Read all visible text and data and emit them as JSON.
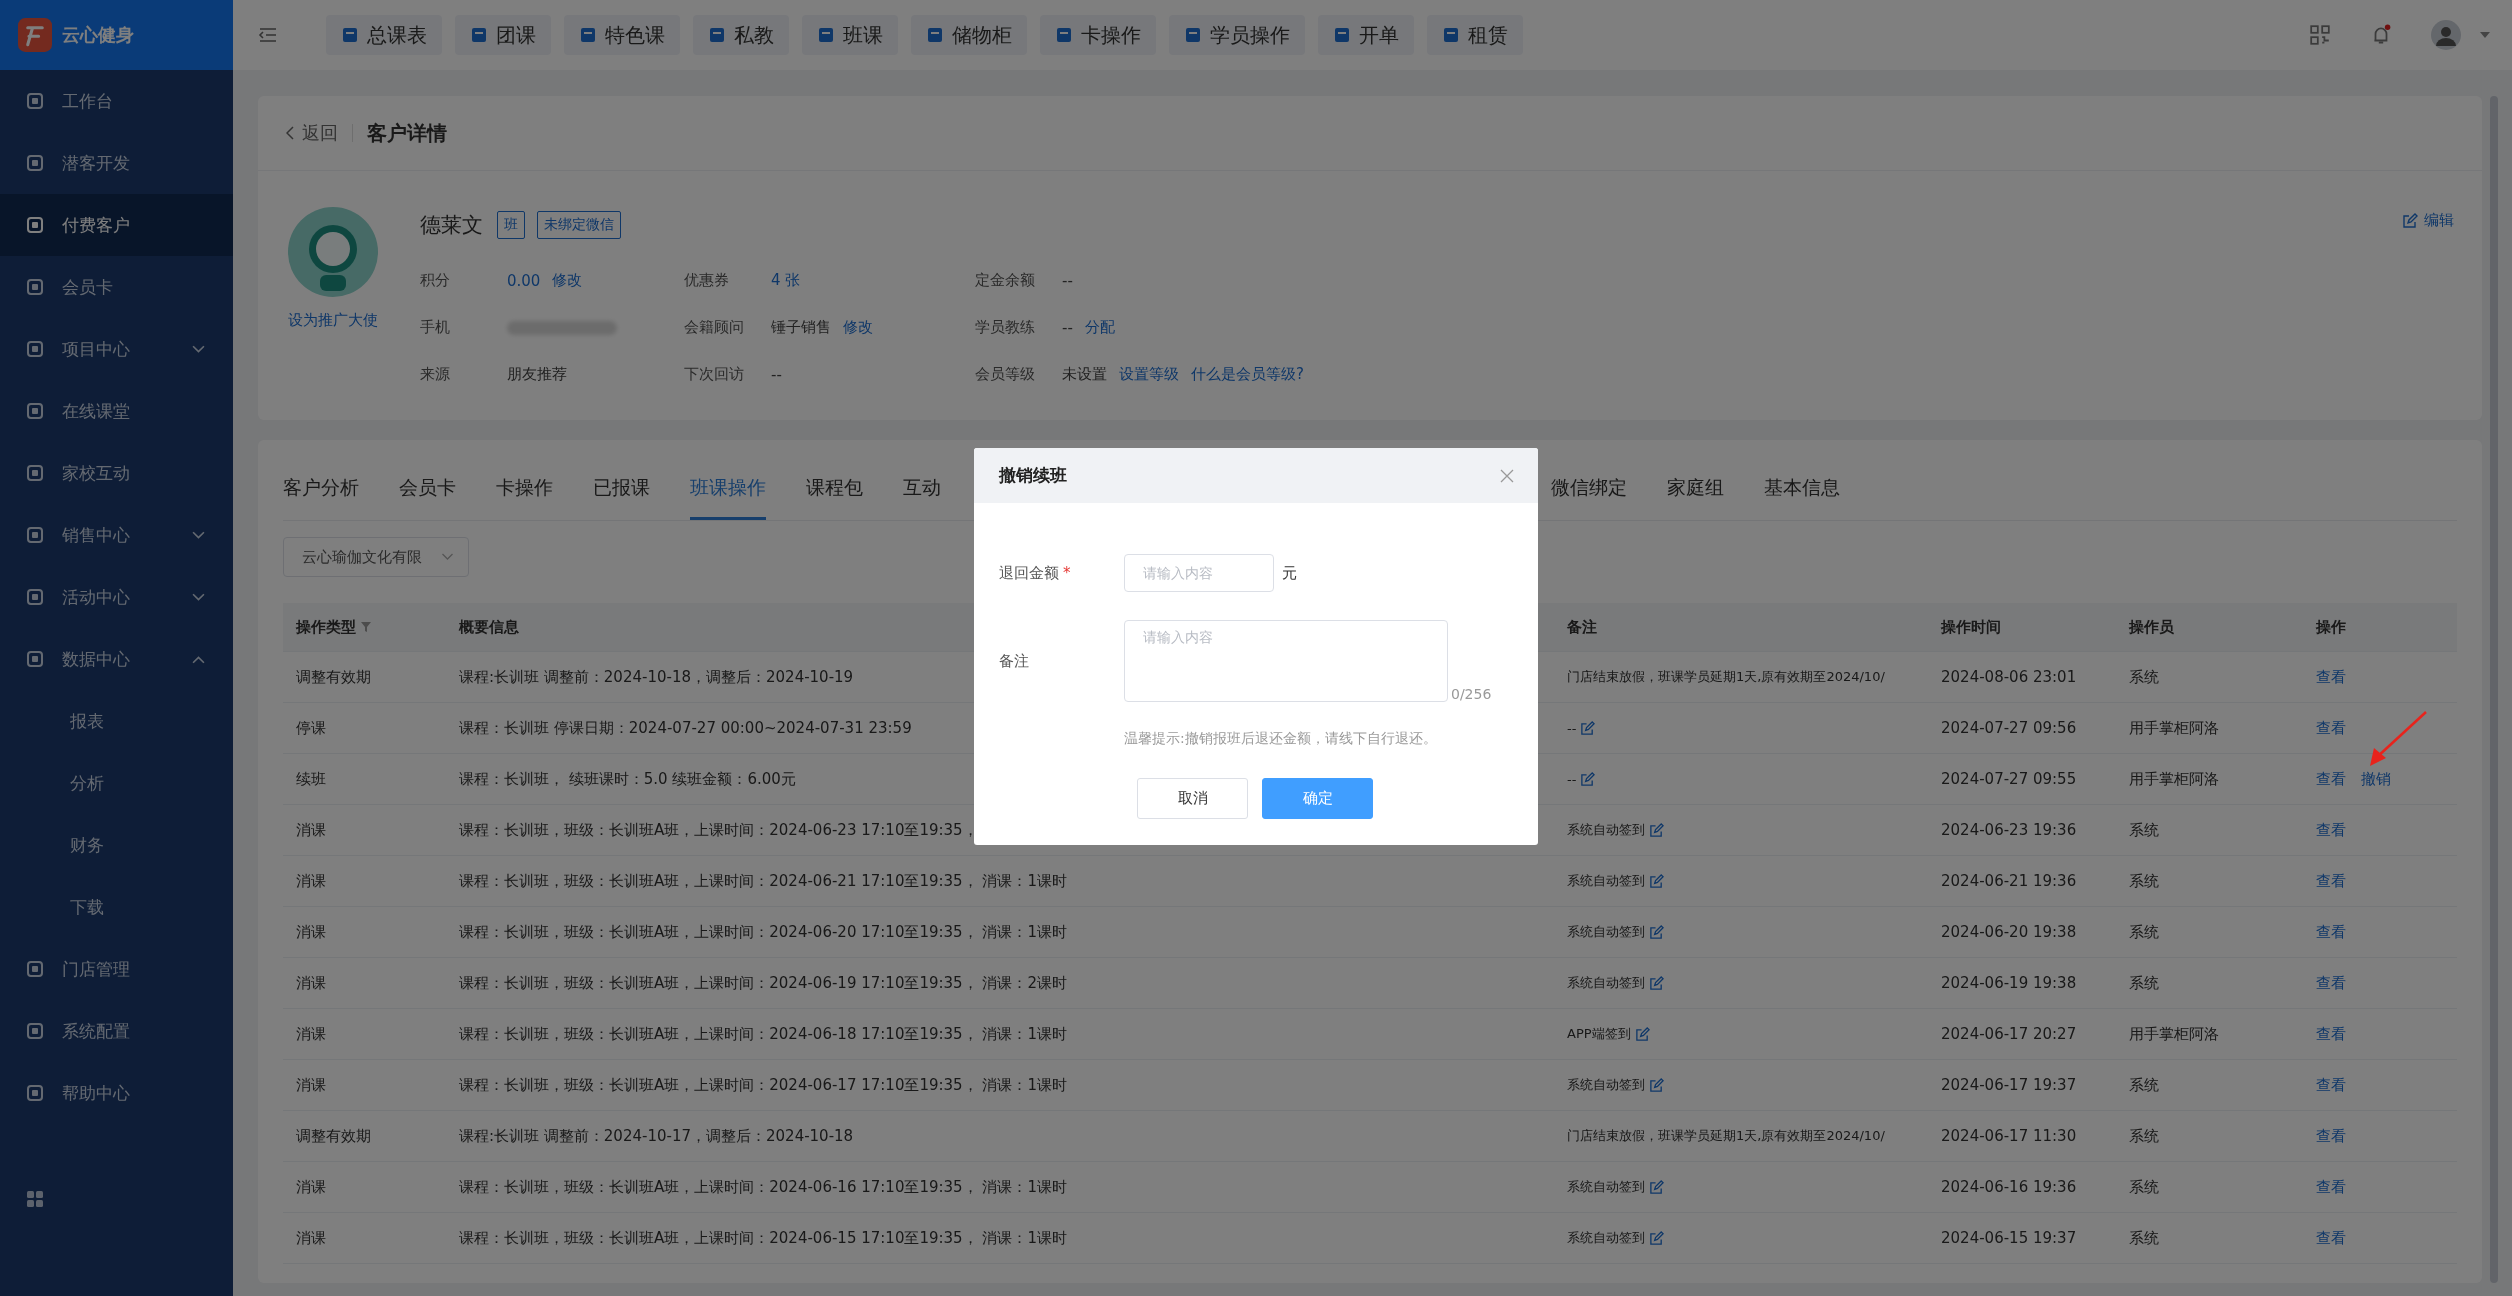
{
  "sidebar": {
    "brand": "云心健身",
    "items": [
      {
        "label": "工作台",
        "selected": false
      },
      {
        "label": "潜客开发",
        "selected": false
      },
      {
        "label": "付费客户",
        "selected": true
      },
      {
        "label": "会员卡",
        "selected": false
      },
      {
        "label": "项目中心",
        "selected": false,
        "expanded": false
      },
      {
        "label": "在线课堂",
        "selected": false
      },
      {
        "label": "家校互动",
        "selected": false
      },
      {
        "label": "销售中心",
        "selected": false,
        "expanded": false
      },
      {
        "label": "活动中心",
        "selected": false,
        "expanded": false
      },
      {
        "label": "数据中心",
        "selected": false,
        "expanded": true,
        "children": [
          {
            "label": "报表",
            "selected": false
          },
          {
            "label": "分析",
            "selected": false
          },
          {
            "label": "财务",
            "selected": false
          },
          {
            "label": "下载",
            "selected": false
          }
        ]
      },
      {
        "label": "门店管理",
        "selected": false
      },
      {
        "label": "系统配置",
        "selected": false
      },
      {
        "label": "帮助中心",
        "selected": false
      }
    ]
  },
  "topbar": {
    "nav": [
      "总课表",
      "团课",
      "特色课",
      "私教",
      "班课",
      "储物柜",
      "卡操作",
      "学员操作",
      "开单",
      "租赁"
    ],
    "notification_dot": true
  },
  "page": {
    "back": "返回",
    "title": "客户详情",
    "edit": "编辑"
  },
  "customer": {
    "ambassador_link": "设为推广大使",
    "name": "德莱文",
    "tags": [
      "班",
      "未绑定微信"
    ],
    "fields": [
      {
        "label": "积分",
        "kind": "link",
        "value": "0.00",
        "links": [
          "修改"
        ]
      },
      {
        "label": "优惠券",
        "kind": "link",
        "value": "4 张"
      },
      {
        "label": "定金余额",
        "kind": "text",
        "value": "--"
      },
      {
        "label": "手机",
        "kind": "blurred"
      },
      {
        "label": "会籍顾问",
        "kind": "text",
        "value": "锤子销售",
        "links": [
          "修改"
        ]
      },
      {
        "label": "学员教练",
        "kind": "text",
        "value": "--",
        "links": [
          "分配"
        ]
      },
      {
        "label": "来源",
        "kind": "text",
        "value": "朋友推荐"
      },
      {
        "label": "下次回访",
        "kind": "text",
        "value": "--"
      },
      {
        "label": "会员等级",
        "kind": "text",
        "value": "未设置",
        "links": [
          "设置等级",
          "什么是会员等级?"
        ]
      }
    ]
  },
  "tabs": [
    {
      "label": "客户分析",
      "selected": false
    },
    {
      "label": "会员卡",
      "selected": false
    },
    {
      "label": "卡操作",
      "selected": false
    },
    {
      "label": "已报课",
      "selected": false
    },
    {
      "label": "班课操作",
      "selected": true
    },
    {
      "label": "课程包",
      "selected": false
    },
    {
      "label": "互动",
      "selected": false
    },
    {
      "label": "微信绑定",
      "selected": false
    },
    {
      "label": "家庭组",
      "selected": false
    },
    {
      "label": "基本信息",
      "selected": false
    }
  ],
  "filter": {
    "value": "云心瑜伽文化有限"
  },
  "table": {
    "columns": [
      {
        "label": "操作类型",
        "filter": true
      },
      {
        "label": "概要信息"
      },
      {
        "label": "备注"
      },
      {
        "label": "操作时间"
      },
      {
        "label": "操作员"
      },
      {
        "label": "操作"
      }
    ],
    "rows": [
      {
        "type": "调整有效期",
        "summary": "课程:长训班 调整前：2024-10-18，调整后：2024-10-19",
        "remark": "门店结束放假，班课学员延期1天,原有效期至2024/10/",
        "remark_editable": false,
        "time": "2024-08-06 23:01",
        "operator": "系统",
        "actions": [
          "查看"
        ]
      },
      {
        "type": "停课",
        "summary": "课程：长训班 停课日期：2024-07-27 00:00~2024-07-31 23:59",
        "remark": "--",
        "remark_editable": true,
        "time": "2024-07-27 09:56",
        "operator": "用手掌柜阿洛",
        "actions": [
          "查看"
        ]
      },
      {
        "type": "续班",
        "summary": "课程：长训班， 续班课时：5.0 续班金额：6.00元",
        "remark": "--",
        "remark_editable": true,
        "time": "2024-07-27 09:55",
        "operator": "用手掌柜阿洛",
        "actions": [
          "查看",
          "撤销"
        ]
      },
      {
        "type": "消课",
        "summary": "课程：长训班，班级：长训班A班，上课时间：2024-06-23 17:10至19:35，",
        "remark": "系统自动签到",
        "remark_editable": true,
        "time": "2024-06-23 19:36",
        "operator": "系统",
        "actions": [
          "查看"
        ]
      },
      {
        "type": "消课",
        "summary": "课程：长训班，班级：长训班A班，上课时间：2024-06-21 17:10至19:35， 消课：1课时",
        "remark": "系统自动签到",
        "remark_editable": true,
        "time": "2024-06-21 19:36",
        "operator": "系统",
        "actions": [
          "查看"
        ]
      },
      {
        "type": "消课",
        "summary": "课程：长训班，班级：长训班A班，上课时间：2024-06-20 17:10至19:35， 消课：1课时",
        "remark": "系统自动签到",
        "remark_editable": true,
        "time": "2024-06-20 19:38",
        "operator": "系统",
        "actions": [
          "查看"
        ]
      },
      {
        "type": "消课",
        "summary": "课程：长训班，班级：长训班A班，上课时间：2024-06-19 17:10至19:35， 消课：2课时",
        "remark": "系统自动签到",
        "remark_editable": true,
        "time": "2024-06-19 19:38",
        "operator": "系统",
        "actions": [
          "查看"
        ]
      },
      {
        "type": "消课",
        "summary": "课程：长训班，班级：长训班A班，上课时间：2024-06-18 17:10至19:35， 消课：1课时",
        "remark": "APP端签到",
        "remark_editable": true,
        "time": "2024-06-17 20:27",
        "operator": "用手掌柜阿洛",
        "actions": [
          "查看"
        ]
      },
      {
        "type": "消课",
        "summary": "课程：长训班，班级：长训班A班，上课时间：2024-06-17 17:10至19:35， 消课：1课时",
        "remark": "系统自动签到",
        "remark_editable": true,
        "time": "2024-06-17 19:37",
        "operator": "系统",
        "actions": [
          "查看"
        ]
      },
      {
        "type": "调整有效期",
        "summary": "课程:长训班 调整前：2024-10-17，调整后：2024-10-18",
        "remark": "门店结束放假，班课学员延期1天,原有效期至2024/10/",
        "remark_editable": false,
        "time": "2024-06-17 11:30",
        "operator": "系统",
        "actions": [
          "查看"
        ]
      },
      {
        "type": "消课",
        "summary": "课程：长训班，班级：长训班A班，上课时间：2024-06-16 17:10至19:35， 消课：1课时",
        "remark": "系统自动签到",
        "remark_editable": true,
        "time": "2024-06-16 19:36",
        "operator": "系统",
        "actions": [
          "查看"
        ]
      },
      {
        "type": "消课",
        "summary": "课程：长训班，班级：长训班A班，上课时间：2024-06-15 17:10至19:35， 消课：1课时",
        "remark": "系统自动签到",
        "remark_editable": true,
        "time": "2024-06-15 19:37",
        "operator": "系统",
        "actions": [
          "查看"
        ]
      }
    ]
  },
  "modal": {
    "title": "撤销续班",
    "fields": [
      {
        "label": "退回金额",
        "required_mark": "*",
        "kind": "input",
        "placeholder": "请输入内容",
        "suffix": "元"
      },
      {
        "label": "备注",
        "kind": "textarea",
        "placeholder": "请输入内容",
        "counter": "0/256"
      }
    ],
    "hint": "温馨提示:撤销报班后退还金额，请线下自行退还。",
    "buttons": [
      {
        "label": "取消",
        "primary": false
      },
      {
        "label": "确定",
        "primary": true
      }
    ]
  }
}
